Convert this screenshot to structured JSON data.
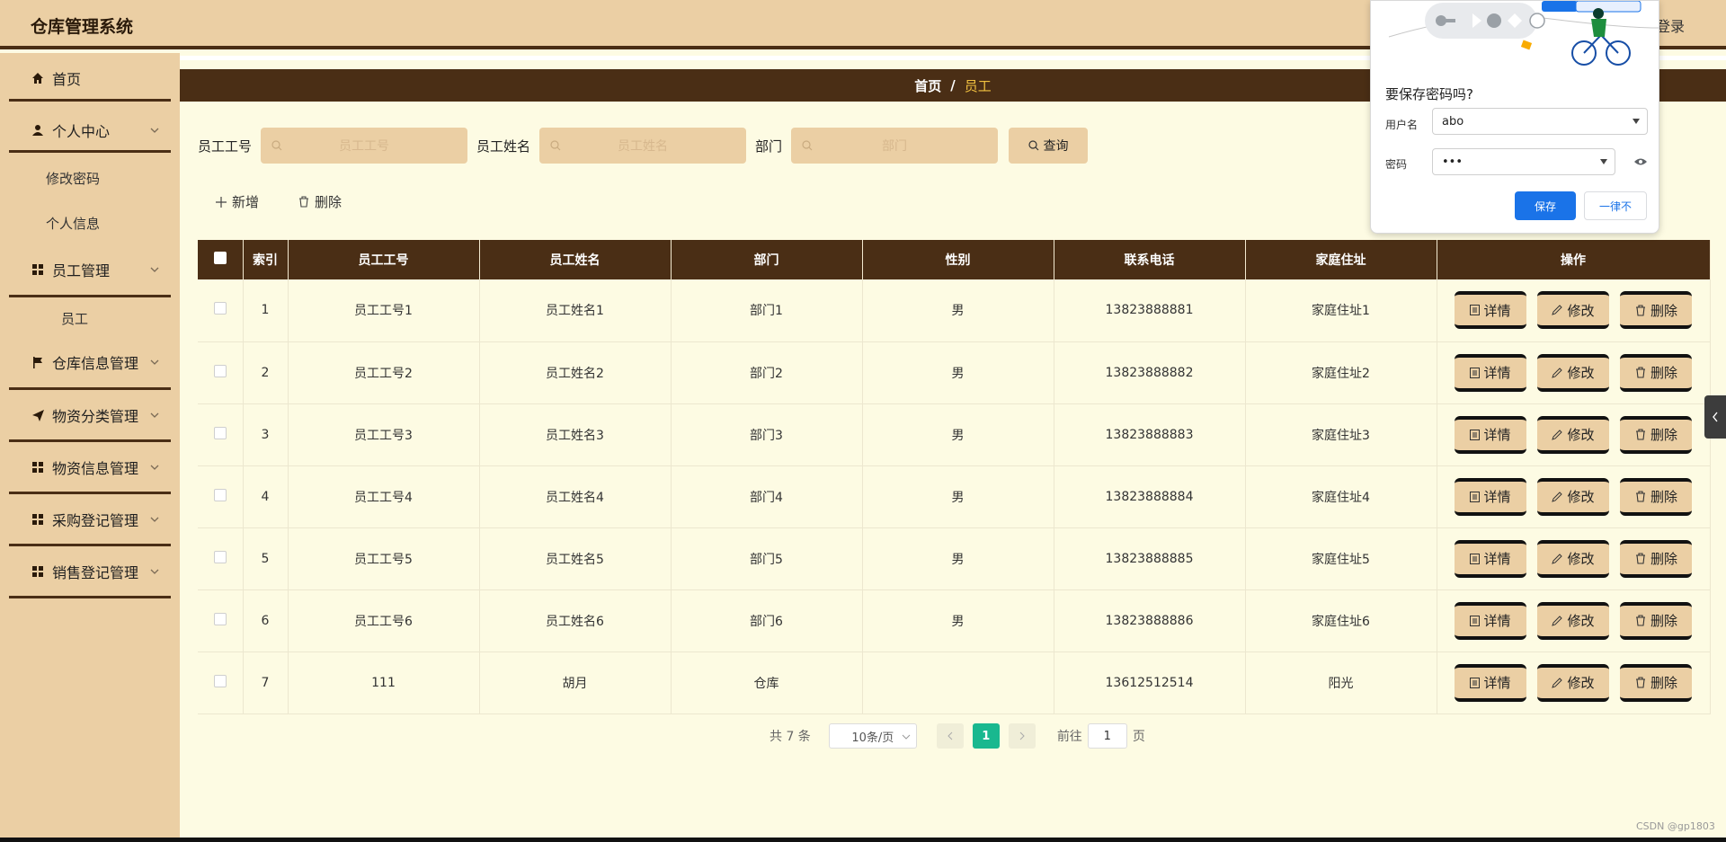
{
  "app": {
    "title": "仓库管理系统",
    "login_label": "登录"
  },
  "sidebar": {
    "home": "首页",
    "personal": "个人中心",
    "personal_sub": [
      "修改密码",
      "个人信息"
    ],
    "employee": "员工管理",
    "employee_sub": [
      "员工"
    ],
    "warehouse": "仓库信息管理",
    "category": "物资分类管理",
    "goods": "物资信息管理",
    "purchase": "采购登记管理",
    "sales": "销售登记管理"
  },
  "breadcrumb": {
    "home": "首页",
    "sep": "/",
    "current": "员工"
  },
  "search": {
    "emp_no_label": "员工工号",
    "emp_no_placeholder": "员工工号",
    "emp_name_label": "员工姓名",
    "emp_name_placeholder": "员工姓名",
    "dept_label": "部门",
    "dept_placeholder": "部门",
    "query_label": "查询"
  },
  "actions": {
    "add": "新增",
    "delete": "删除"
  },
  "table": {
    "headers": [
      "索引",
      "员工工号",
      "员工姓名",
      "部门",
      "性别",
      "联系电话",
      "家庭住址",
      "操作"
    ],
    "row_buttons": {
      "detail": "详情",
      "edit": "修改",
      "delete": "删除"
    },
    "rows": [
      {
        "idx": "1",
        "no": "员工工号1",
        "name": "员工姓名1",
        "dept": "部门1",
        "gender": "男",
        "phone": "13823888881",
        "addr": "家庭住址1"
      },
      {
        "idx": "2",
        "no": "员工工号2",
        "name": "员工姓名2",
        "dept": "部门2",
        "gender": "男",
        "phone": "13823888882",
        "addr": "家庭住址2"
      },
      {
        "idx": "3",
        "no": "员工工号3",
        "name": "员工姓名3",
        "dept": "部门3",
        "gender": "男",
        "phone": "13823888883",
        "addr": "家庭住址3"
      },
      {
        "idx": "4",
        "no": "员工工号4",
        "name": "员工姓名4",
        "dept": "部门4",
        "gender": "男",
        "phone": "13823888884",
        "addr": "家庭住址4"
      },
      {
        "idx": "5",
        "no": "员工工号5",
        "name": "员工姓名5",
        "dept": "部门5",
        "gender": "男",
        "phone": "13823888885",
        "addr": "家庭住址5"
      },
      {
        "idx": "6",
        "no": "员工工号6",
        "name": "员工姓名6",
        "dept": "部门6",
        "gender": "男",
        "phone": "13823888886",
        "addr": "家庭住址6"
      },
      {
        "idx": "7",
        "no": "111",
        "name": "胡月",
        "dept": "仓库",
        "gender": "",
        "phone": "13612512514",
        "addr": "阳光"
      }
    ]
  },
  "pagination": {
    "total": "共 7 条",
    "page_size": "10条/页",
    "current_page": "1",
    "goto_label": "前往",
    "goto_value": "1",
    "page_unit": "页"
  },
  "password_popup": {
    "title": "要保存密码吗?",
    "username_label": "用户名",
    "username_value": "abo",
    "password_label": "密码",
    "password_value": "•••",
    "save_label": "保存",
    "never_label": "一律不"
  },
  "watermark": "CSDN @gp1803",
  "colors": {
    "brand_dark": "#4a2e15",
    "brand_light": "#ebcfa4",
    "background": "#fdfbe3",
    "pager_active": "#19b88f",
    "chrome_blue": "#1a73e8"
  }
}
